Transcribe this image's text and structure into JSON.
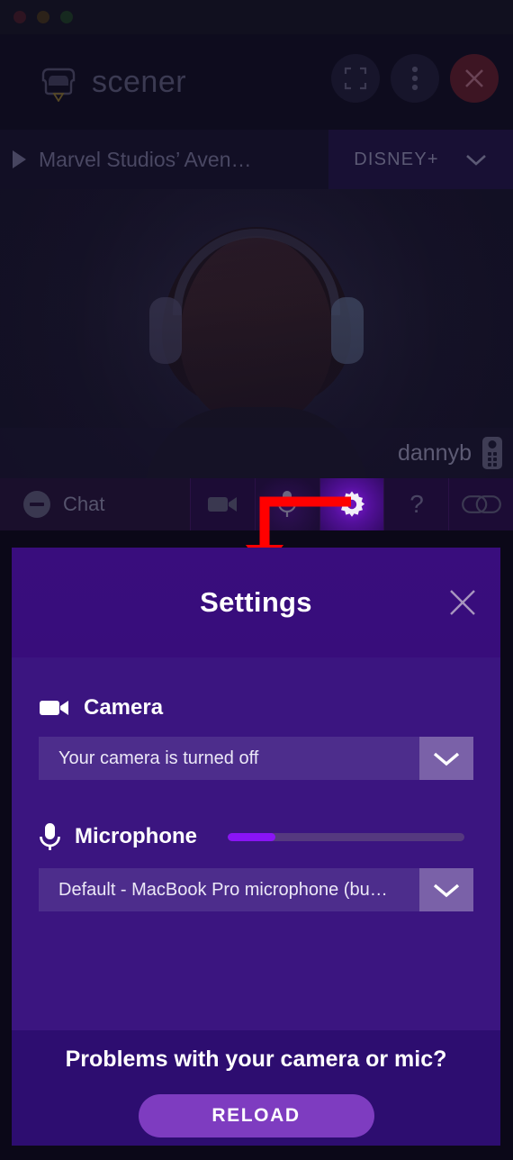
{
  "window": {
    "traffic_lights": [
      "close",
      "minimize",
      "zoom"
    ]
  },
  "header": {
    "brand": "scener",
    "logo_icon": "couch-logo-icon",
    "actions": [
      {
        "name": "fullscreen-icon",
        "label": ""
      },
      {
        "name": "more-options-icon",
        "label": ""
      },
      {
        "name": "close-icon",
        "label": ""
      }
    ]
  },
  "media_bar": {
    "play_icon": "play-icon",
    "title": "Marvel Studios’ Aven…",
    "service": "DISNEY+",
    "chevron_icon": "chevron-down-icon"
  },
  "video": {
    "username": "dannyb",
    "remote_icon": "remote-control-icon"
  },
  "toolbar": {
    "chat_label": "Chat",
    "chat_icon": "minus-circle-icon",
    "buttons": [
      {
        "name": "camera-toggle-button",
        "icon": "video-camera-icon",
        "active": false
      },
      {
        "name": "microphone-toggle-button",
        "icon": "microphone-icon",
        "active": false
      },
      {
        "name": "settings-button",
        "icon": "gear-icon",
        "active": true
      },
      {
        "name": "help-button",
        "icon": "question-mark-icon",
        "active": false
      },
      {
        "name": "invite-link-button",
        "icon": "link-chain-icon",
        "active": false
      }
    ]
  },
  "annotation": {
    "type": "arrow",
    "color": "#ff0000",
    "points_to": "settings-button"
  },
  "settings_panel": {
    "title": "Settings",
    "close_icon": "close-icon",
    "camera": {
      "icon": "video-camera-icon",
      "label": "Camera",
      "selected": "Your camera is turned off",
      "chevron_icon": "chevron-down-icon"
    },
    "microphone": {
      "icon": "microphone-icon",
      "label": "Microphone",
      "selected": "Default - MacBook Pro microphone (bu…",
      "chevron_icon": "chevron-down-icon",
      "level_percent": 20,
      "level_color": "#8a14f5"
    },
    "footer": {
      "question": "Problems with your camera or mic?",
      "reload_label": "RELOAD"
    }
  },
  "colors": {
    "panel_bg": "#3b1580",
    "panel_header": "#390d7d",
    "panel_footer": "#2d0d70",
    "accent": "#7e3cc0",
    "gear_active": "#7d17d6",
    "annotation": "#ff0000"
  }
}
